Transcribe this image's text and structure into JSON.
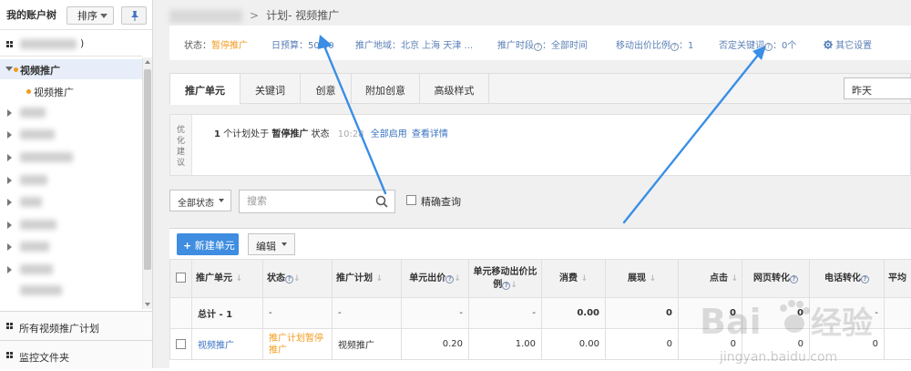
{
  "sidebar": {
    "title": "我的账户树",
    "sort_label": "排序",
    "account_suffix": ")",
    "tree": {
      "campaign": "视频推广",
      "unit": "视频推广"
    },
    "footer": [
      {
        "label": "所有视频推广计划"
      },
      {
        "label": "监控文件夹"
      }
    ]
  },
  "breadcrumb": {
    "separator": ">",
    "current": "计划- 视频推广"
  },
  "status_bar": {
    "status_key": "状态：",
    "status_value": "暂停推广",
    "budget": "日预算：50.00",
    "region": "推广地域：北京 上海 天津 ...",
    "period_key": "推广时段",
    "period_value": "：全部时间",
    "mobile_key": "移动出价比例",
    "mobile_value": "：1",
    "negative_key": "否定关键词",
    "negative_value": "：0个",
    "other_settings": "其它设置"
  },
  "tabs": [
    {
      "label": "推广单元",
      "active": true
    },
    {
      "label": "关键词"
    },
    {
      "label": "创意"
    },
    {
      "label": "附加创意"
    },
    {
      "label": "高级样式"
    }
  ],
  "date_range": "昨天",
  "advice": {
    "tag": [
      "优",
      "化",
      "建",
      "议"
    ],
    "count": "1",
    "text_a": "个计划处于",
    "state": "暂停推广",
    "text_b": "状态",
    "time": "10:28",
    "enable_all": "全部启用",
    "view_detail": "查看详情"
  },
  "filter": {
    "status_dropdown": "全部状态",
    "search_placeholder": "搜索",
    "exact_label": "精确查询"
  },
  "toolbar": {
    "new_unit": "新建单元",
    "edit": "编辑"
  },
  "table": {
    "headers": [
      "推广单元",
      "状态",
      "推广计划",
      "单元出价",
      "单元移动出价比例",
      "消费",
      "展现",
      "点击",
      "网页转化",
      "电话转化",
      "平均"
    ],
    "total_row": [
      "总计 - 1",
      "-",
      "-",
      "-",
      "-",
      "0.00",
      "0",
      "0",
      "0",
      "-",
      ""
    ],
    "rows": [
      [
        "视频推广",
        "推广计划暂停推广",
        "视频推广",
        "0.20",
        "1.00",
        "0.00",
        "0",
        "0",
        "0",
        "0",
        ""
      ]
    ]
  },
  "colors": {
    "accent_blue": "#3e8de0",
    "link_blue": "#3b73c2",
    "warning_orange": "#f29b1d",
    "annotation_arrow": "#3a8ee6"
  },
  "watermark": {
    "brand": "Bai",
    "brand_tail": "经验",
    "url": "jingyan.baidu.com"
  }
}
